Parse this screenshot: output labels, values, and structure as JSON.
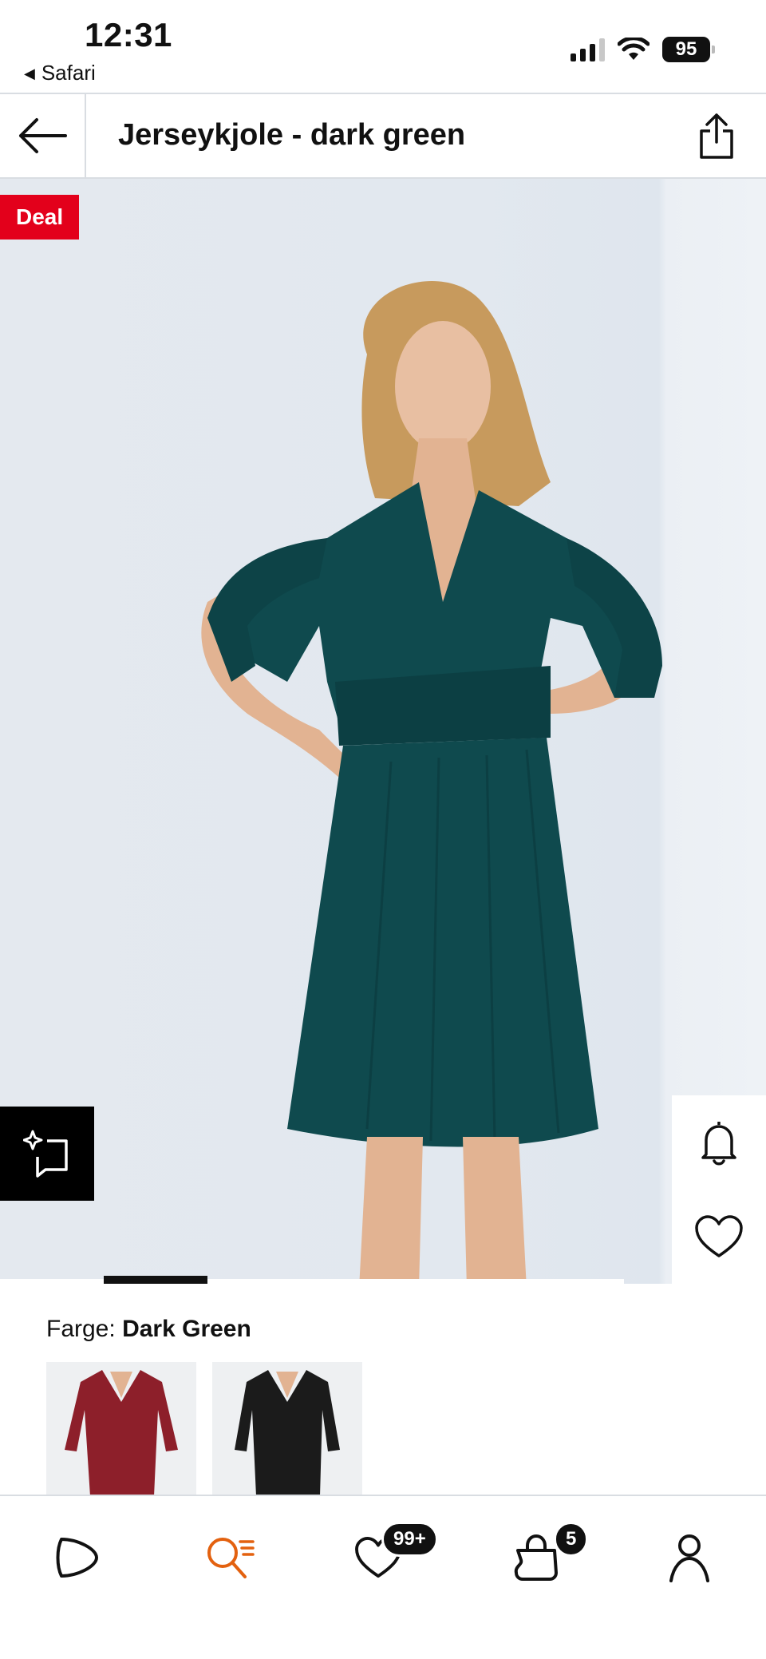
{
  "status_bar": {
    "time": "12:31",
    "back_app": "Safari",
    "battery": "95"
  },
  "header": {
    "title": "Jerseykjole - dark green"
  },
  "product": {
    "badge": "Deal",
    "image_description_icon": "model-in-dark-green-dress",
    "gallery_progress": 0.2,
    "dress_color": "#0f4a4e"
  },
  "color_section": {
    "label_prefix": "Farge:",
    "selected_color": "Dark Green",
    "swatches": [
      {
        "color": "#8d1f2a"
      },
      {
        "color": "#1b1b1b"
      }
    ]
  },
  "tabbar": {
    "active_color": "#e3610f",
    "tabs": [
      {
        "name": "home",
        "icon": "play-logo-icon"
      },
      {
        "name": "search",
        "icon": "search-icon"
      },
      {
        "name": "wishlist",
        "icon": "heart-icon",
        "badge": "99+"
      },
      {
        "name": "bag",
        "icon": "bag-icon",
        "badge": "5"
      },
      {
        "name": "account",
        "icon": "user-icon"
      }
    ]
  }
}
